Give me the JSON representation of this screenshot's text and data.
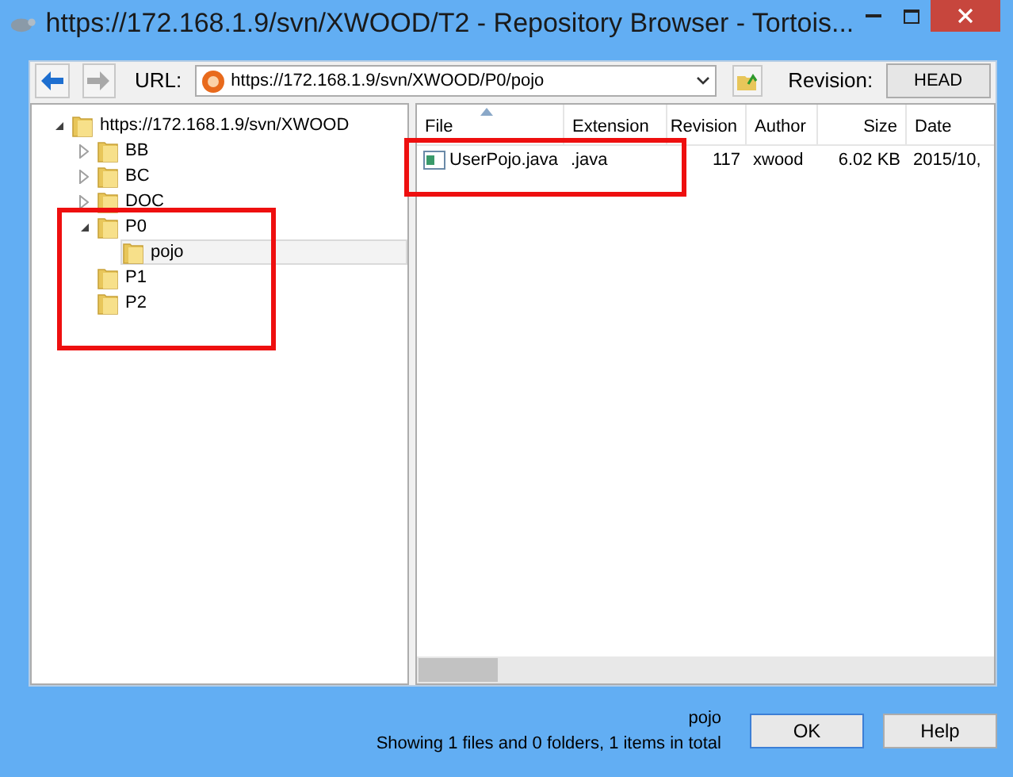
{
  "window": {
    "title": "https://172.168.1.9/svn/XWOOD/T2 - Repository Browser - Tortois..."
  },
  "toolbar": {
    "back": {
      "disabled": false
    },
    "forward": {
      "disabled": true
    },
    "url_label": "URL:",
    "url": "https://172.168.1.9/svn/XWOOD/P0/pojo",
    "revision_label": "Revision:",
    "revision": "HEAD"
  },
  "tree": [
    {
      "label": "https://172.168.1.9/svn/XWOOD",
      "expanded": true,
      "selected": false,
      "children": [
        {
          "label": "BB",
          "expanded": false,
          "selected": false
        },
        {
          "label": "BC",
          "expanded": false,
          "selected": false
        },
        {
          "label": "DOC",
          "expanded": false,
          "selected": false
        },
        {
          "label": "P0",
          "expanded": true,
          "selected": false,
          "children": [
            {
              "label": "pojo",
              "selected": true
            }
          ]
        },
        {
          "label": "P1",
          "selected": false
        },
        {
          "label": "P2",
          "selected": false
        }
      ]
    }
  ],
  "file_list": {
    "columns": [
      {
        "label": "File",
        "sorted": true
      },
      {
        "label": "Extension",
        "sorted": false
      },
      {
        "label": "Revision",
        "sorted": false
      },
      {
        "label": "Author",
        "sorted": false
      },
      {
        "label": "Size",
        "sorted": false
      },
      {
        "label": "Date",
        "sorted": false
      }
    ],
    "rows": [
      [
        "UserPojo.java",
        ".java",
        "117",
        "xwood",
        "6.02 KB",
        "2015/10,"
      ]
    ]
  },
  "status": {
    "selected_item": "pojo",
    "summary": "Showing 1 files and 0 folders, 1 items in total"
  },
  "buttons": [
    {
      "label": "OK",
      "default": true
    },
    {
      "label": "Help",
      "default": false
    }
  ]
}
